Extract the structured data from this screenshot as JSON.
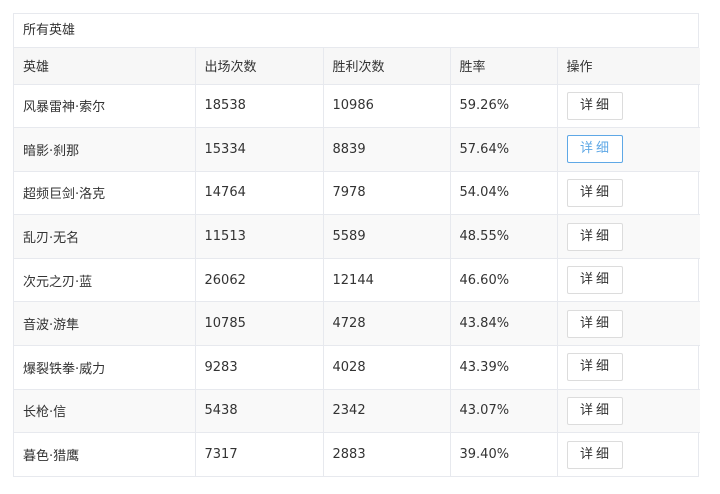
{
  "panel": {
    "title": "所有英雄"
  },
  "table": {
    "headers": [
      "英雄",
      "出场次数",
      "胜利次数",
      "胜率",
      "操作"
    ],
    "rows": [
      {
        "hero": "风暴雷神·索尔",
        "appearances": "18538",
        "wins": "10986",
        "win_rate": "59.26%",
        "action": "详细"
      },
      {
        "hero": "暗影·刹那",
        "appearances": "15334",
        "wins": "8839",
        "win_rate": "57.64%",
        "action": "详细"
      },
      {
        "hero": "超频巨剑·洛克",
        "appearances": "14764",
        "wins": "7978",
        "win_rate": "54.04%",
        "action": "详细"
      },
      {
        "hero": "乱刃·无名",
        "appearances": "11513",
        "wins": "5589",
        "win_rate": "48.55%",
        "action": "详细"
      },
      {
        "hero": "次元之刃·蓝",
        "appearances": "26062",
        "wins": "12144",
        "win_rate": "46.60%",
        "action": "详细"
      },
      {
        "hero": "音波·游隼",
        "appearances": "10785",
        "wins": "4728",
        "win_rate": "43.84%",
        "action": "详细"
      },
      {
        "hero": "爆裂铁拳·威力",
        "appearances": "9283",
        "wins": "4028",
        "win_rate": "43.39%",
        "action": "详细"
      },
      {
        "hero": "长枪·信",
        "appearances": "5438",
        "wins": "2342",
        "win_rate": "43.07%",
        "action": "详细"
      },
      {
        "hero": "暮色·猎鹰",
        "appearances": "7317",
        "wins": "2883",
        "win_rate": "39.40%",
        "action": "详细"
      }
    ]
  },
  "colors": {
    "border": "#e7e9ee",
    "header_bg": "#f7f7f7",
    "active_button": "#5fa8e6"
  }
}
